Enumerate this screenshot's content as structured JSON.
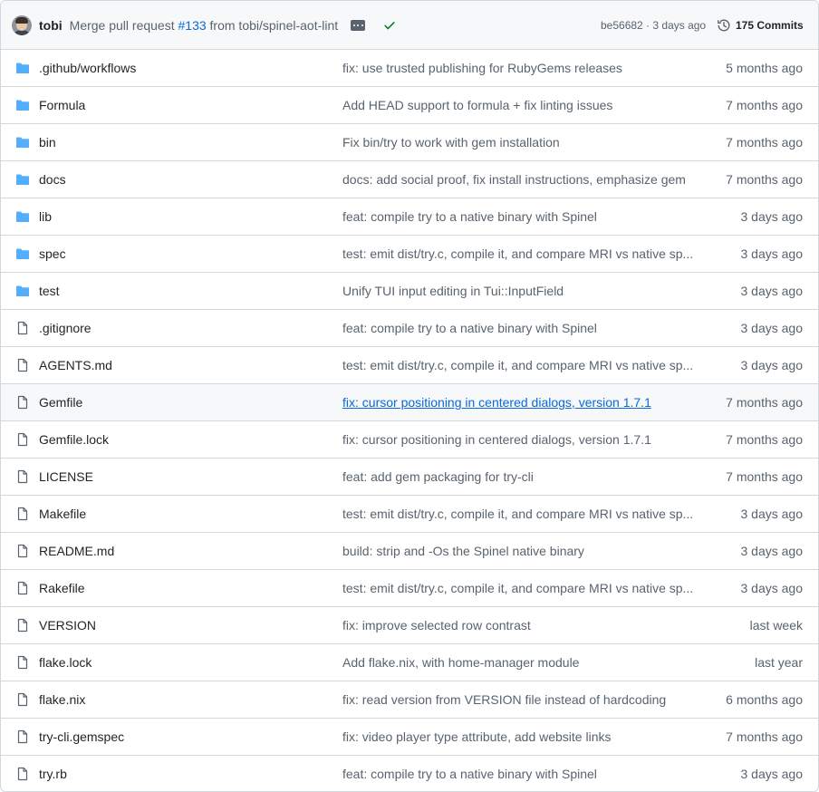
{
  "header": {
    "author": "tobi",
    "commit_message_prefix": "Merge pull request",
    "pr_number": "#133",
    "commit_message_suffix": "from tobi/spinel-aot-lint",
    "commit_sha_age": "be56682 · 3 days ago",
    "commits_label": "175 Commits",
    "status_icon": "check-icon",
    "status_color": "#1a7f37"
  },
  "colors": {
    "folder": "#54aeff",
    "file": "#59636e",
    "link": "#0969da"
  },
  "rows": [
    {
      "type": "folder",
      "name": ".github/workflows",
      "message": "fix: use trusted publishing for RubyGems releases",
      "age": "5 months ago"
    },
    {
      "type": "folder",
      "name": "Formula",
      "message": "Add HEAD support to formula + fix linting issues",
      "age": "7 months ago"
    },
    {
      "type": "folder",
      "name": "bin",
      "message": "Fix bin/try to work with gem installation",
      "age": "7 months ago"
    },
    {
      "type": "folder",
      "name": "docs",
      "message": "docs: add social proof, fix install instructions, emphasize gem",
      "age": "7 months ago"
    },
    {
      "type": "folder",
      "name": "lib",
      "message": "feat: compile try to a native binary with Spinel",
      "age": "3 days ago"
    },
    {
      "type": "folder",
      "name": "spec",
      "message": "test: emit dist/try.c, compile it, and compare MRI vs native sp...",
      "age": "3 days ago"
    },
    {
      "type": "folder",
      "name": "test",
      "message": "Unify TUI input editing in Tui::InputField",
      "age": "3 days ago"
    },
    {
      "type": "file",
      "name": ".gitignore",
      "message": "feat: compile try to a native binary with Spinel",
      "age": "3 days ago"
    },
    {
      "type": "file",
      "name": "AGENTS.md",
      "message": "test: emit dist/try.c, compile it, and compare MRI vs native sp...",
      "age": "3 days ago"
    },
    {
      "type": "file",
      "name": "Gemfile",
      "message": "fix: cursor positioning in centered dialogs, version 1.7.1",
      "age": "7 months ago",
      "hovered": true
    },
    {
      "type": "file",
      "name": "Gemfile.lock",
      "message": "fix: cursor positioning in centered dialogs, version 1.7.1",
      "age": "7 months ago"
    },
    {
      "type": "file",
      "name": "LICENSE",
      "message": "feat: add gem packaging for try-cli",
      "age": "7 months ago"
    },
    {
      "type": "file",
      "name": "Makefile",
      "message": "test: emit dist/try.c, compile it, and compare MRI vs native sp...",
      "age": "3 days ago"
    },
    {
      "type": "file",
      "name": "README.md",
      "message": "build: strip and -Os the Spinel native binary",
      "age": "3 days ago"
    },
    {
      "type": "file",
      "name": "Rakefile",
      "message": "test: emit dist/try.c, compile it, and compare MRI vs native sp...",
      "age": "3 days ago"
    },
    {
      "type": "file",
      "name": "VERSION",
      "message": "fix: improve selected row contrast",
      "age": "last week"
    },
    {
      "type": "file",
      "name": "flake.lock",
      "message": "Add flake.nix, with home-manager module",
      "age": "last year"
    },
    {
      "type": "file",
      "name": "flake.nix",
      "message": "fix: read version from VERSION file instead of hardcoding",
      "age": "6 months ago"
    },
    {
      "type": "file",
      "name": "try-cli.gemspec",
      "message": "fix: video player type attribute, add website links",
      "age": "7 months ago"
    },
    {
      "type": "file",
      "name": "try.rb",
      "message": "feat: compile try to a native binary with Spinel",
      "age": "3 days ago"
    }
  ]
}
